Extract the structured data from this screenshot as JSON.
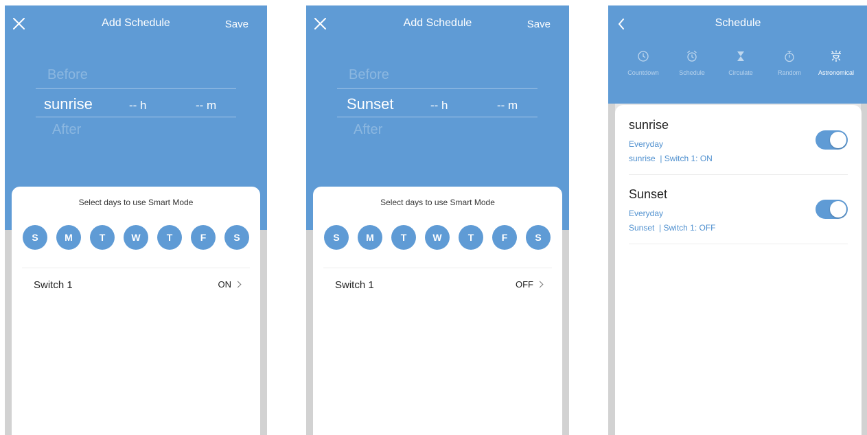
{
  "screens": [
    {
      "title": "Add Schedule",
      "save_label": "Save",
      "picker": {
        "before": "Before",
        "selected": "sunrise",
        "hours": "-- h",
        "minutes": "-- m",
        "after": "After"
      },
      "days_heading": "Select days to use Smart Mode",
      "days": [
        "S",
        "M",
        "T",
        "W",
        "T",
        "F",
        "S"
      ],
      "switch_label": "Switch 1",
      "switch_value": "ON"
    },
    {
      "title": "Add Schedule",
      "save_label": "Save",
      "picker": {
        "before": "Before",
        "selected": "Sunset",
        "hours": "-- h",
        "minutes": "-- m",
        "after": "After"
      },
      "days_heading": "Select days to use Smart Mode",
      "days": [
        "S",
        "M",
        "T",
        "W",
        "T",
        "F",
        "S"
      ],
      "switch_label": "Switch 1",
      "switch_value": "OFF"
    },
    {
      "title": "Schedule",
      "tabs": [
        {
          "label": "Countdown",
          "icon": "clock-icon"
        },
        {
          "label": "Schedule",
          "icon": "alarm-clock-icon"
        },
        {
          "label": "Circulate",
          "icon": "hourglass-icon"
        },
        {
          "label": "Random",
          "icon": "stopwatch-icon"
        },
        {
          "label": "Astronomical",
          "icon": "sun-horizon-icon",
          "active": true
        }
      ],
      "schedules": [
        {
          "name": "sunrise",
          "repeat": "Everyday",
          "detail": "sunrise  | Switch 1: ON",
          "enabled": true
        },
        {
          "name": "Sunset",
          "repeat": "Everyday",
          "detail": "Sunset  | Switch 1: OFF",
          "enabled": true
        }
      ]
    }
  ],
  "colors": {
    "accent": "#5f9bd5",
    "link_text": "#4f90cf",
    "background": "#e7e7e7"
  }
}
